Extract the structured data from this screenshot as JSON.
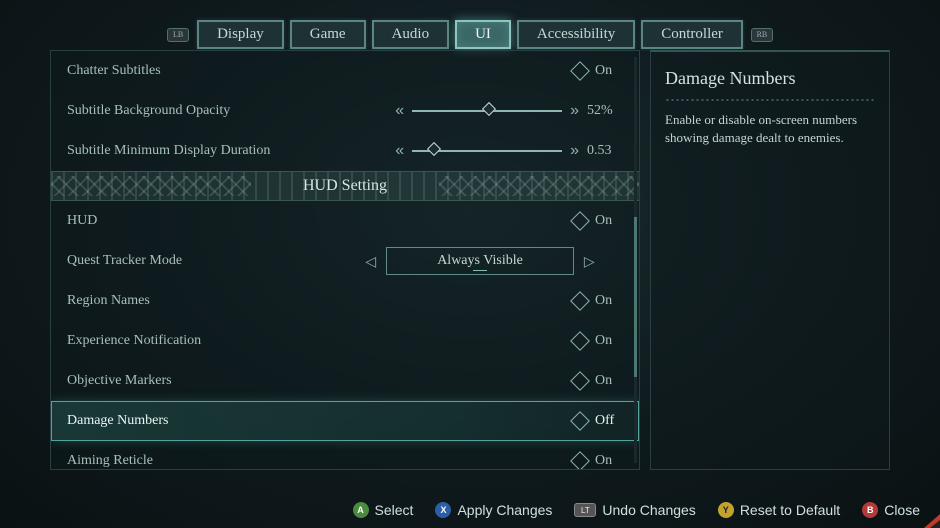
{
  "tabs": {
    "items": [
      "Display",
      "Game",
      "Audio",
      "UI",
      "Accessibility",
      "Controller"
    ],
    "active_index": 3,
    "lb": "LB",
    "rb": "RB"
  },
  "settings": [
    {
      "label": "Chatter Subtitles",
      "type": "toggle",
      "value": "On"
    },
    {
      "label": "Subtitle Background Opacity",
      "type": "slider",
      "value": "52%",
      "pos": 0.52
    },
    {
      "label": "Subtitle Minimum Display Duration",
      "type": "slider",
      "value": "0.53",
      "pos": 0.15
    },
    {
      "label": "HUD Setting",
      "type": "section"
    },
    {
      "label": "HUD",
      "type": "toggle",
      "value": "On"
    },
    {
      "label": "Quest Tracker Mode",
      "type": "select",
      "value": "Always Visible"
    },
    {
      "label": "Region Names",
      "type": "toggle",
      "value": "On"
    },
    {
      "label": "Experience Notification",
      "type": "toggle",
      "value": "On"
    },
    {
      "label": "Objective Markers",
      "type": "toggle",
      "value": "On"
    },
    {
      "label": "Damage Numbers",
      "type": "toggle",
      "value": "Off",
      "selected": true
    },
    {
      "label": "Aiming Reticle",
      "type": "toggle",
      "value": "On"
    }
  ],
  "side": {
    "title": "Damage Numbers",
    "desc": "Enable or disable on-screen numbers showing damage dealt to enemies."
  },
  "footer": {
    "select": "Select",
    "apply": "Apply Changes",
    "undo": "Undo Changes",
    "reset": "Reset to Default",
    "close": "Close"
  }
}
